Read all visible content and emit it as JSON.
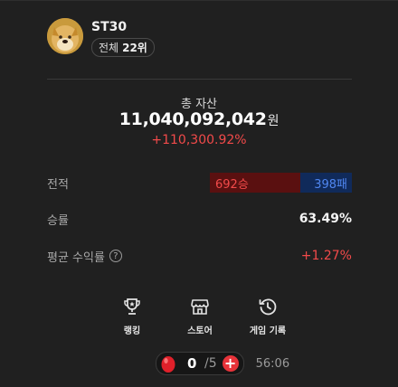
{
  "profile": {
    "username": "ST30",
    "rank_label": "전체",
    "rank_value": "22위"
  },
  "assets": {
    "label": "총 자산",
    "value": "11,040,092,042",
    "unit": "원",
    "rate": "+110,300.92%"
  },
  "stats": {
    "record_label": "전적",
    "wins": "692승",
    "losses": "398패",
    "win_fraction": 0.635,
    "win_rate_label": "승률",
    "win_rate": "63.49%",
    "avg_return_label": "평균 수익률",
    "avg_return": "+1.27%",
    "help_icon": "question-circle-icon"
  },
  "nav": [
    {
      "label": "랭킹",
      "icon": "trophy-icon"
    },
    {
      "label": "스토어",
      "icon": "store-icon"
    },
    {
      "label": "게임 기록",
      "icon": "history-icon"
    }
  ],
  "energy": {
    "count": "0",
    "max": "/5",
    "timer": "56:06",
    "icon": "red-egg-icon",
    "plus_icon": "plus-icon"
  },
  "colors": {
    "background": "#202020",
    "up_red": "#f24a4a",
    "down_blue": "#4f86f0",
    "win_bar": "#5a1010",
    "loss_bar": "#102a5a",
    "plus_button": "#e8333a"
  }
}
